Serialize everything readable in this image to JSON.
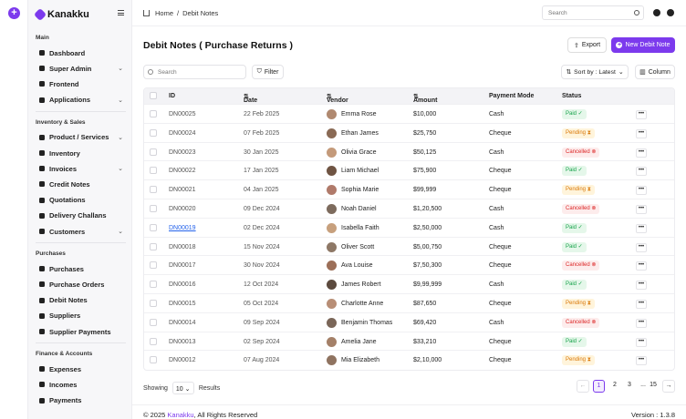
{
  "app": {
    "name": "Kanakku"
  },
  "breadcrumb": {
    "home": "Home",
    "sep": "/",
    "current": "Debit Notes"
  },
  "top_search": {
    "placeholder": "Search"
  },
  "sidebar": {
    "sections": [
      {
        "title": "Main",
        "items": [
          {
            "label": "Dashboard",
            "icon": "grid-icon",
            "chevron": false
          },
          {
            "label": "Super Admin",
            "icon": "star-icon",
            "chevron": true
          },
          {
            "label": "Frontend",
            "icon": "globe-icon",
            "chevron": false
          },
          {
            "label": "Applications",
            "icon": "apps-icon",
            "chevron": true
          }
        ]
      },
      {
        "title": "Inventory & Sales",
        "items": [
          {
            "label": "Product / Services",
            "icon": "box-icon",
            "chevron": true
          },
          {
            "label": "Inventory",
            "icon": "inventory-icon",
            "chevron": false
          },
          {
            "label": "Invoices",
            "icon": "invoice-icon",
            "chevron": true
          },
          {
            "label": "Credit Notes",
            "icon": "credit-note-icon",
            "chevron": false
          },
          {
            "label": "Quotations",
            "icon": "quote-icon",
            "chevron": false
          },
          {
            "label": "Delivery Challans",
            "icon": "truck-icon",
            "chevron": false
          },
          {
            "label": "Customers",
            "icon": "users-icon",
            "chevron": true
          }
        ]
      },
      {
        "title": "Purchases",
        "items": [
          {
            "label": "Purchases",
            "icon": "purchase-icon",
            "chevron": false
          },
          {
            "label": "Purchase Orders",
            "icon": "order-icon",
            "chevron": false
          },
          {
            "label": "Debit Notes",
            "icon": "debit-note-icon",
            "chevron": false
          },
          {
            "label": "Suppliers",
            "icon": "supplier-icon",
            "chevron": false
          },
          {
            "label": "Supplier Payments",
            "icon": "payment-icon",
            "chevron": false
          }
        ]
      },
      {
        "title": "Finance & Accounts",
        "items": [
          {
            "label": "Expenses",
            "icon": "expense-icon",
            "chevron": false
          },
          {
            "label": "Incomes",
            "icon": "income-icon",
            "chevron": false
          },
          {
            "label": "Payments",
            "icon": "wallet-icon",
            "chevron": false
          }
        ]
      }
    ]
  },
  "page": {
    "title": "Debit Notes ( Purchase Returns )"
  },
  "actions": {
    "export": "Export",
    "new": "New Debit Note"
  },
  "list_search": {
    "placeholder": "Search"
  },
  "filter": {
    "label": "Filter"
  },
  "sort": {
    "label": "Sort by : Latest"
  },
  "columns_btn": {
    "label": "Column"
  },
  "table": {
    "headers": [
      "ID",
      "Date",
      "Vendor",
      "Amount",
      "Payment Mode",
      "Status"
    ],
    "rows": [
      {
        "id": "DN00025",
        "date": "22 Feb 2025",
        "vendor": "Emma Rose",
        "amount": "$10,000",
        "mode": "Cash",
        "status": "Paid"
      },
      {
        "id": "DN00024",
        "date": "07 Feb 2025",
        "vendor": "Ethan James",
        "amount": "$25,750",
        "mode": "Cheque",
        "status": "Pending"
      },
      {
        "id": "DN00023",
        "date": "30 Jan 2025",
        "vendor": "Olivia Grace",
        "amount": "$50,125",
        "mode": "Cash",
        "status": "Cancelled"
      },
      {
        "id": "DN00022",
        "date": "17 Jan 2025",
        "vendor": "Liam Michael",
        "amount": "$75,900",
        "mode": "Cheque",
        "status": "Paid"
      },
      {
        "id": "DN00021",
        "date": "04 Jan 2025",
        "vendor": "Sophia Marie",
        "amount": "$99,999",
        "mode": "Cheque",
        "status": "Pending"
      },
      {
        "id": "DN00020",
        "date": "09 Dec 2024",
        "vendor": "Noah Daniel",
        "amount": "$1,20,500",
        "mode": "Cash",
        "status": "Cancelled"
      },
      {
        "id": "DN00019",
        "date": "02 Dec 2024",
        "vendor": "Isabella Faith",
        "amount": "$2,50,000",
        "mode": "Cash",
        "status": "Paid"
      },
      {
        "id": "DN00018",
        "date": "15 Nov 2024",
        "vendor": "Oliver Scott",
        "amount": "$5,00,750",
        "mode": "Cheque",
        "status": "Paid"
      },
      {
        "id": "DN00017",
        "date": "30 Nov 2024",
        "vendor": "Ava Louise",
        "amount": "$7,50,300",
        "mode": "Cheque",
        "status": "Cancelled"
      },
      {
        "id": "DN00016",
        "date": "12 Oct 2024",
        "vendor": "James Robert",
        "amount": "$9,99,999",
        "mode": "Cash",
        "status": "Paid"
      },
      {
        "id": "DN00015",
        "date": "05 Oct 2024",
        "vendor": "Charlotte Anne",
        "amount": "$87,650",
        "mode": "Cheque",
        "status": "Pending"
      },
      {
        "id": "DN00014",
        "date": "09 Sep 2024",
        "vendor": "Benjamin Thomas",
        "amount": "$69,420",
        "mode": "Cash",
        "status": "Cancelled"
      },
      {
        "id": "DN00013",
        "date": "02 Sep 2024",
        "vendor": "Amelia Jane",
        "amount": "$33,210",
        "mode": "Cheque",
        "status": "Paid"
      },
      {
        "id": "DN00012",
        "date": "07 Aug 2024",
        "vendor": "Mia Elizabeth",
        "amount": "$2,10,000",
        "mode": "Cheque",
        "status": "Pending"
      }
    ]
  },
  "pagination": {
    "showing": "Showing",
    "per_page": "10",
    "results": "Results",
    "pages": [
      "1",
      "2",
      "3",
      "...",
      "15"
    ]
  },
  "footer": {
    "copy_prefix": "© 2025",
    "brand": "Kanakku",
    "copy_suffix": ", All Rights Reserved",
    "version": "Version : 1.3.8"
  },
  "colors": {
    "accent": "#7c3aed",
    "paid": "#16a34a",
    "pending": "#d97706",
    "cancelled": "#dc2626"
  }
}
